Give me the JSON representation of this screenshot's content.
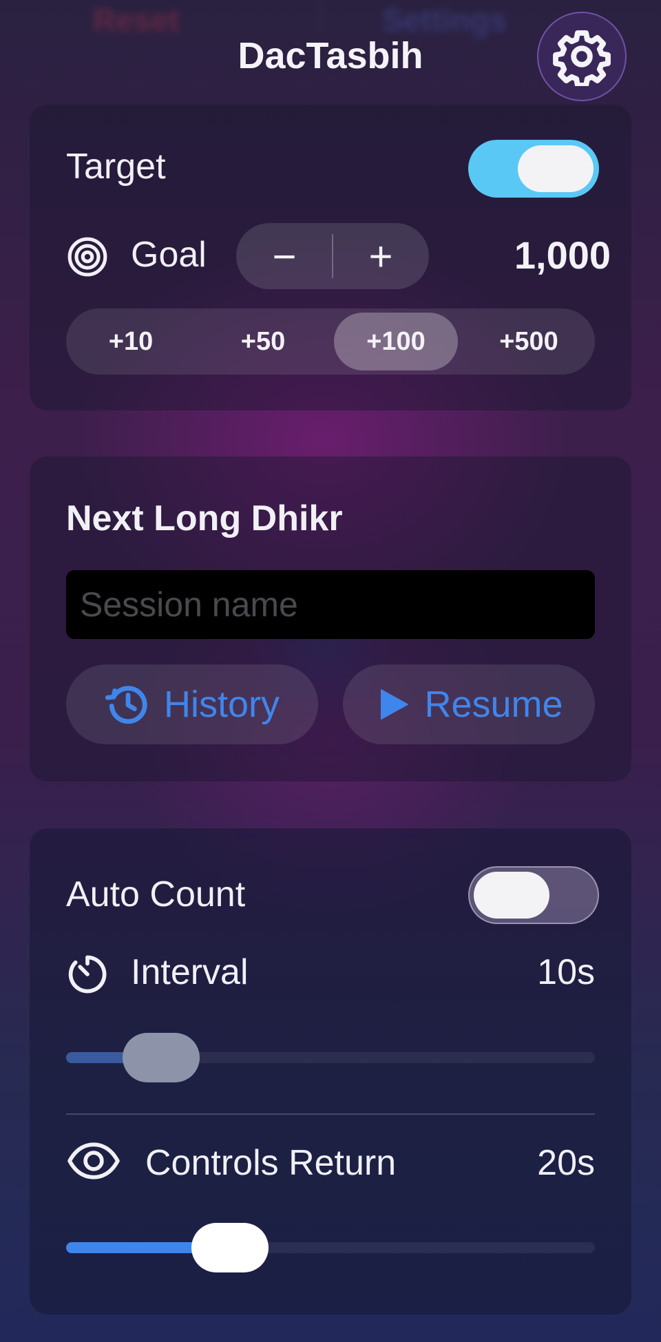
{
  "header": {
    "title": "DacTasbih",
    "settings_icon": "gear-icon",
    "background_buttons": {
      "reset_label": "Reset",
      "settings_label": "Settings"
    }
  },
  "target_card": {
    "label": "Target",
    "enabled": true,
    "goal_label": "Goal",
    "goal_icon": "target-icon",
    "decrement": "−",
    "increment": "+",
    "goal_value": "1,000",
    "presets": [
      "+10",
      "+50",
      "+100",
      "+500"
    ],
    "selected_preset": "+100"
  },
  "dhikr_card": {
    "title": "Next Long Dhikr",
    "session_placeholder": "Session name",
    "session_value": "",
    "history_label": "History",
    "history_icon": "history-icon",
    "resume_label": "Resume",
    "resume_icon": "play-icon"
  },
  "auto_card": {
    "label": "Auto Count",
    "enabled": false,
    "interval_label": "Interval",
    "interval_icon": "timer-icon",
    "interval_value": "10s",
    "interval_slider_fraction": 0.18,
    "controls_return_label": "Controls Return",
    "controls_return_icon": "eye-icon",
    "controls_return_value": "20s",
    "controls_return_slider_fraction": 0.31
  },
  "colors": {
    "accent_blue": "#3f86ec",
    "toggle_on": "#5ac8f5",
    "slider_active": "#3f86ec",
    "slider_inactive": "#3a5aa0"
  }
}
